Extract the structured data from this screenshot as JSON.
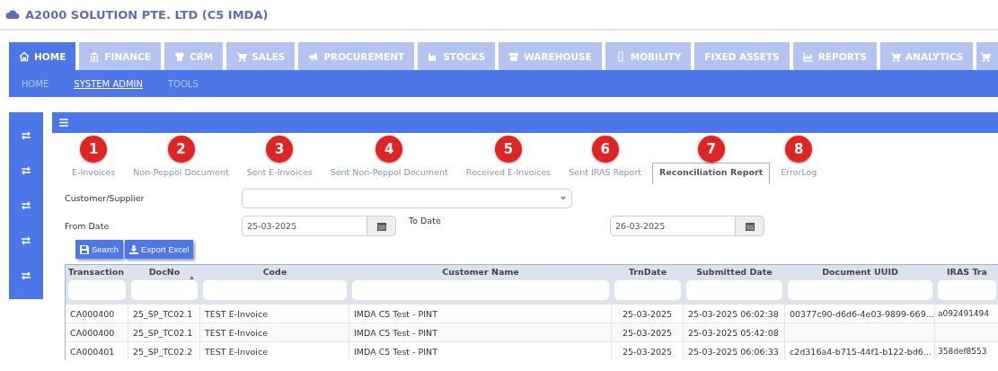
{
  "window": {
    "title": "A2000 SOLUTION PTE. LTD (C5 IMDA)"
  },
  "modules": [
    {
      "label": "HOME",
      "selected": true
    },
    {
      "label": "FINANCE",
      "selected": false
    },
    {
      "label": "CRM",
      "selected": false
    },
    {
      "label": "SALES",
      "selected": false
    },
    {
      "label": "PROCUREMENT",
      "selected": false
    },
    {
      "label": "STOCKS",
      "selected": false
    },
    {
      "label": "WAREHOUSE",
      "selected": false
    },
    {
      "label": "MOBILITY",
      "selected": false
    },
    {
      "label": "FIXED ASSETS",
      "selected": false
    },
    {
      "label": "REPORTS",
      "selected": false
    },
    {
      "label": "ANALYTICS",
      "selected": false
    },
    {
      "selected": false
    }
  ],
  "subnav": [
    {
      "label": "HOME",
      "selected": false
    },
    {
      "label": "SYSTEM ADMIN",
      "selected": true
    },
    {
      "label": "TOOLS",
      "selected": false
    }
  ],
  "tabs": [
    {
      "badge": "1",
      "label": "E-Invoices",
      "selected": false
    },
    {
      "badge": "2",
      "label": "Non-Peppol Document",
      "selected": false
    },
    {
      "badge": "3",
      "label": "Sent E-Invoices",
      "selected": false
    },
    {
      "badge": "4",
      "label": "Sent Non-Peppol Document",
      "selected": false
    },
    {
      "badge": "5",
      "label": "Received E-Invoices",
      "selected": false
    },
    {
      "badge": "6",
      "label": "Sent IRAS Report",
      "selected": false
    },
    {
      "badge": "7",
      "label": "Reconciliation Report",
      "selected": true
    },
    {
      "badge": "8",
      "label": "ErrorLog",
      "selected": false
    }
  ],
  "form": {
    "customer_label": "Customer/Supplier",
    "from_label": "From Date",
    "from_value": "25-03-2025",
    "to_label": "To Date",
    "to_value": "26-03-2025"
  },
  "buttons": [
    {
      "label": "Search"
    },
    {
      "label": "Export Excel"
    }
  ],
  "table": {
    "columns": [
      {
        "label": "Transaction",
        "sorted": false
      },
      {
        "label": "DocNo",
        "sorted": true
      },
      {
        "label": "Code",
        "sorted": false
      },
      {
        "label": "Customer Name",
        "sorted": false
      },
      {
        "label": "TrnDate",
        "sorted": false
      },
      {
        "label": "Submitted Date",
        "sorted": false
      },
      {
        "label": "Document UUID",
        "sorted": false
      },
      {
        "label": "IRAS Tra",
        "sorted": false
      }
    ],
    "rows": [
      [
        "CA000400",
        "25_SP_TC02.1",
        "TEST E-Invoice",
        "IMDA C5 Test - PINT",
        "25-03-2025",
        "25-03-2025 06:02:38",
        "00377c90-d6d6-4e03-9899-669...",
        "a092491494"
      ],
      [
        "CA000400",
        "25_SP_TC02.1",
        "TEST E-Invoice",
        "IMDA C5 Test - PINT",
        "25-03-2025",
        "25-03-2025 05:42:08",
        "",
        ""
      ],
      [
        "CA000401",
        "25_SP_TC02.2",
        "TEST E-Invoice",
        "IMDA C5 Test - PINT",
        "25-03-2025",
        "25-03-2025 06:06:33",
        "c2d316a4-b715-44f1-b122-bd6...",
        "358def8553"
      ]
    ]
  }
}
